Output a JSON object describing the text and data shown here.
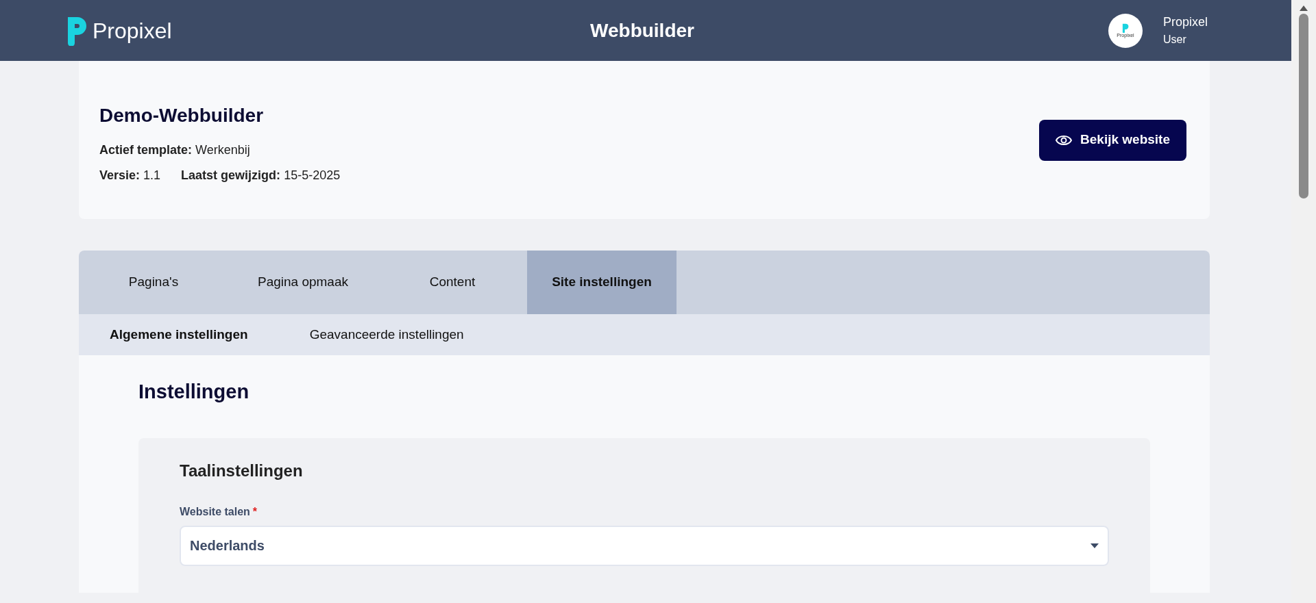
{
  "header": {
    "logo": "Propixel",
    "title": "Webbuilder",
    "avatar_text": "Propixel",
    "user_name": "Propixel",
    "user_role": "User"
  },
  "project": {
    "name": "Demo-Webbuilder",
    "info_lines": [
      [
        {
          "label": "Actief template:",
          "value": "Werkenbij"
        }
      ],
      [
        {
          "label": "Versie:",
          "value": "1.1"
        },
        {
          "label": "Laatst gewijzigd:",
          "value": "15-5-2025"
        }
      ]
    ],
    "view_button": "Bekijk website"
  },
  "tabs": [
    {
      "label": "Pagina's",
      "selected": false
    },
    {
      "label": "Pagina opmaak",
      "selected": false
    },
    {
      "label": "Content",
      "selected": false
    },
    {
      "label": "Site instellingen",
      "selected": true
    }
  ],
  "subtabs": [
    {
      "label": "Algemene instellingen",
      "selected": true
    },
    {
      "label": "Geavanceerde instellingen",
      "selected": false
    }
  ],
  "settings": {
    "title": "Instellingen",
    "section": {
      "title": "Taalinstellingen",
      "field": {
        "label": "Website talen",
        "required": true,
        "required_mark": "*",
        "value": "Nederlands"
      }
    }
  }
}
